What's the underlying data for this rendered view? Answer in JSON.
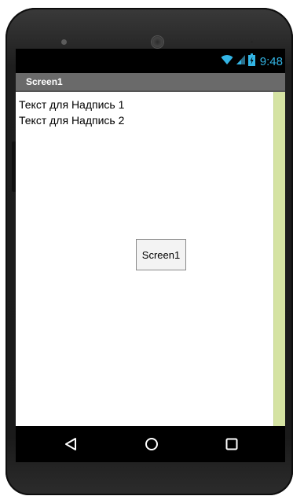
{
  "status_bar": {
    "time": "9:48",
    "icons": [
      "wifi-icon",
      "signal-icon",
      "battery-charging-icon"
    ],
    "icon_color": "#33b5e5"
  },
  "title_bar": {
    "title": "Screen1"
  },
  "screen": {
    "labels": [
      "Текст для Надпись 1",
      "Текст для Надпись 2"
    ],
    "button_label": "Screen1",
    "scrollbar_color": "#d5e3a3"
  },
  "nav_bar": {
    "icons": [
      "back-icon",
      "home-icon",
      "recent-apps-icon"
    ]
  }
}
